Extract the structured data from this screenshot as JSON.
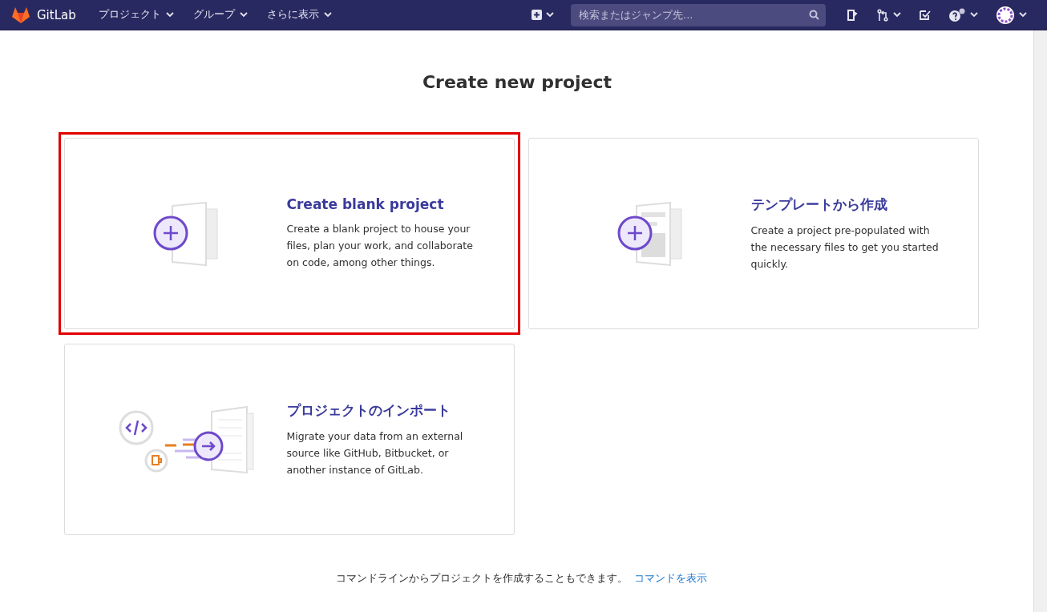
{
  "navbar": {
    "brand": "GitLab",
    "menus": [
      {
        "label": "プロジェクト"
      },
      {
        "label": "グループ"
      },
      {
        "label": "さらに表示"
      }
    ],
    "search": {
      "placeholder": "検索またはジャンプ先..."
    }
  },
  "page": {
    "title": "Create new project",
    "cards": [
      {
        "kind": "blank",
        "title": "Create blank project",
        "description": "Create a blank project to house your files, plan your work, and collaborate on code, among other things.",
        "selected": true
      },
      {
        "kind": "template",
        "title": "テンプレートから作成",
        "description": "Create a project pre-populated with the necessary files to get you started quickly.",
        "selected": false
      },
      {
        "kind": "import",
        "title": "プロジェクトのインポート",
        "description": "Migrate your data from an external source like GitHub, Bitbucket, or another instance of GitLab.",
        "selected": false
      }
    ],
    "footer": {
      "text": "コマンドラインからプロジェクトを作成することもできます。",
      "link": "コマンドを表示"
    }
  }
}
